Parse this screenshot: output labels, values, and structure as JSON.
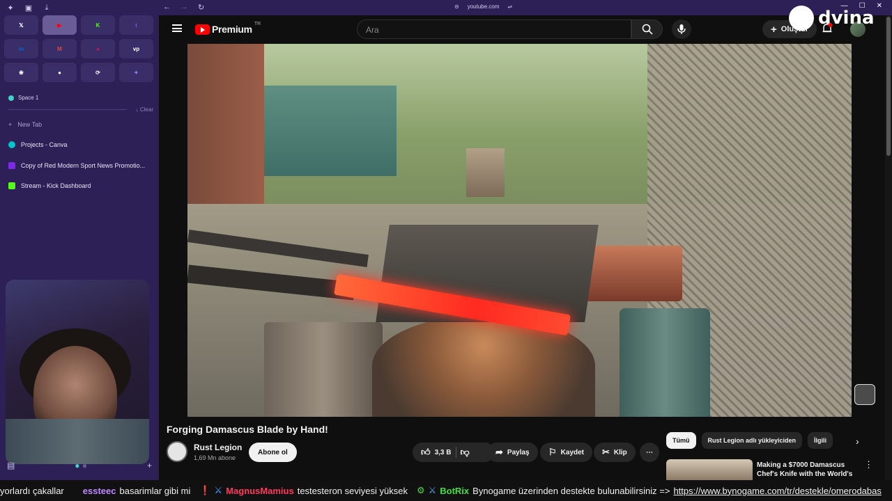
{
  "browser": {
    "url": "youtube.com",
    "space_label": "Space 1",
    "clear_label": "Clear",
    "new_tab_label": "New Tab",
    "favorites": [
      {
        "icon": "x-icon",
        "glyph": "𝕏",
        "color": "#ffffff"
      },
      {
        "icon": "youtube-icon",
        "glyph": "▶",
        "color": "#ff0000"
      },
      {
        "icon": "kick-icon",
        "glyph": "K",
        "color": "#53fc18"
      },
      {
        "icon": "twitch-icon",
        "glyph": "t",
        "color": "#9146ff"
      },
      {
        "icon": "linkedin-icon",
        "glyph": "in",
        "color": "#0a66c2"
      },
      {
        "icon": "gmail-icon",
        "glyph": "M",
        "color": "#ea4335"
      },
      {
        "icon": "youtube-music-icon",
        "glyph": "●",
        "color": "#ff0033"
      },
      {
        "icon": "vp-icon",
        "glyph": "vp",
        "color": "#ffffff"
      },
      {
        "icon": "openai-icon",
        "glyph": "❀",
        "color": "#ffffff"
      },
      {
        "icon": "record-icon",
        "glyph": "●",
        "color": "#ffffff"
      },
      {
        "icon": "sync-icon",
        "glyph": "⟳",
        "color": "#ffffff"
      },
      {
        "icon": "gemini-icon",
        "glyph": "✦",
        "color": "#8a7dff"
      }
    ],
    "tabs": [
      {
        "title": "Projects - Canva",
        "icon_color": "#00c4cc"
      },
      {
        "title": "Copy of Red Modern Sport News Promotio...",
        "icon_color": "#7d2ae8"
      },
      {
        "title": "Stream - Kick Dashboard",
        "icon_color": "#53fc18"
      }
    ]
  },
  "youtube": {
    "logo_text": "Premium",
    "logo_region": "TR",
    "search_placeholder": "Ara",
    "create_label": "Oluştur",
    "video_title": "Forging Damascus Blade by Hand!",
    "channel_name": "Rust Legion",
    "channel_subs": "1,69 Mn abone",
    "subscribe_label": "Abone ol",
    "like_count": "3,3 B",
    "share_label": "Paylaş",
    "save_label": "Kaydet",
    "clip_label": "Klip",
    "chips": [
      "Tümü",
      "Rust Legion adlı yükleyiciden",
      "İlgili"
    ],
    "recommended": [
      {
        "title": "Making a $7000 Damascus Chef's Knife with the World's"
      }
    ]
  },
  "overlay": {
    "brand": "dvina"
  },
  "ticker": {
    "lead": "yorlardı çakallar",
    "user1": "essteec",
    "msg1": "basarimlar gibi mi",
    "user2": "MagnusMamius",
    "msg2": "testesteron seviyesi yüksek",
    "user3": "BotRix",
    "msg3": "Bynogame üzerinden destekte bulunabilirsiniz =>",
    "link": "https://www.bynogame.com/tr/destekle/omerodabas"
  }
}
